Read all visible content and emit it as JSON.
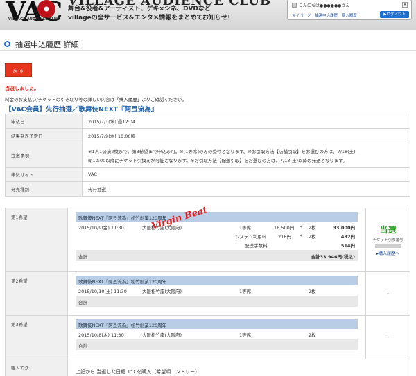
{
  "header": {
    "logo_text": "VAC",
    "logo_caption": "VILLAGE AUDIENCE CLUB",
    "brand_title": "VILLAGE AUDIENCE CLUB",
    "tagline_1": "舞台&役者&アーティスト、ゲキ×シネ、DVDなど",
    "tagline_2": "villageの全サービス&エンタメ情報をまとめてお知らせ！",
    "greeting": "こんにちは●●●●●●さん",
    "links": [
      "マイページ",
      "抽選申込履歴",
      "購入履歴"
    ],
    "logout": "▶ログアウト"
  },
  "page_title": "抽選申込履歴 詳細",
  "back_button": "戻 る",
  "won_message": "当選しました。",
  "note": "料金のお支払い/チケットの引き取り等の詳しい内容は「購入履歴」よりご確認ください。",
  "entry_title": "【VAC会員】先行抽選／歌舞伎NEXT『阿弖流為』",
  "info_rows": [
    {
      "label": "申込日",
      "value": "2015/7/1(水) 昼12:04"
    },
    {
      "label": "結果発表予定日",
      "value": "2015/7/9(木) 18:00頃"
    },
    {
      "label": "注意事項",
      "value_1": "※1人1公演2枚まで。第3希望まで申込み可。※[1等席]のみの受付となります。※お引取方法【店舗引取】をお選びの方は、7/18(土)",
      "value_2": "朝10:00以降にチケット引換えが可能となります。※お引取方法【配送引取】をお選びの方は、7/18(土)以降の発送となります。"
    },
    {
      "label": "申込サイト",
      "value": "VAC"
    },
    {
      "label": "発売種別",
      "value": "先行抽選"
    }
  ],
  "preferences": [
    {
      "label": "第1希望",
      "perf_title": "歌舞伎NEXT『阿弖流為』松竹創業120周年",
      "date": "2015/10/9(金) 11:30",
      "venue": "大阪松竹座(大阪府)",
      "seat": "1等席",
      "unit_price": "16,500円",
      "times": "×",
      "qty": "2枚",
      "amount": "33,000円",
      "system_fee_label": "システム利用料",
      "system_fee_unit": "216円",
      "system_fee_qty": "2枚",
      "system_fee_amount": "432円",
      "delivery_label": "配送手数料",
      "delivery_amount": "514円",
      "total_label": "合計",
      "total_amount": "合計33,946円(税込)",
      "status": "当選",
      "ticket_label": "チケット引換番号",
      "history_link": "▸購入履歴へ"
    },
    {
      "label": "第2希望",
      "perf_title": "歌舞伎NEXT『阿弖流為』松竹創業120周年",
      "date": "2015/10/10(土) 11:30",
      "venue": "大阪松竹座(大阪府)",
      "seat": "1等席",
      "qty": "2枚",
      "total_label": "合計",
      "status": "-"
    },
    {
      "label": "第3希望",
      "perf_title": "歌舞伎NEXT『阿弖流為』松竹創業120周年",
      "date": "2015/10/8(木) 11:30",
      "venue": "大阪松竹座(大阪府)",
      "seat": "1等席",
      "qty": "2枚",
      "total_label": "合計",
      "status": "-"
    }
  ],
  "purchase_method": {
    "label": "購入方法",
    "value": "上記から 当選した日程 1つ を購入（希望順エントリー）"
  },
  "watermark": "Virgin Beat"
}
